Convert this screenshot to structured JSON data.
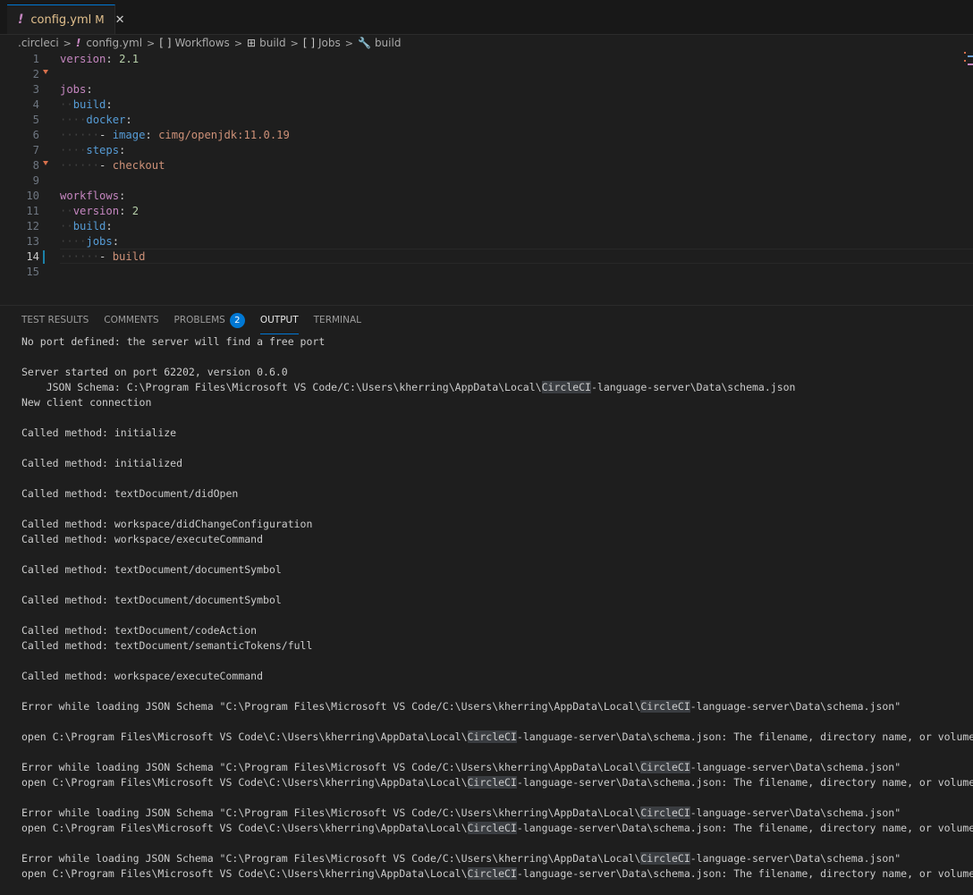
{
  "tab": {
    "icon": "!",
    "filename": "config.yml",
    "status": "M",
    "close": "✕"
  },
  "breadcrumb": {
    "items": [
      {
        "icon": "",
        "label": ".circleci"
      },
      {
        "icon": "!",
        "label": "config.yml"
      },
      {
        "icon": "[ ]",
        "label": "Workflows"
      },
      {
        "icon": "⊞",
        "label": "build"
      },
      {
        "icon": "[ ]",
        "label": "Jobs"
      },
      {
        "icon": "🔧",
        "label": "build"
      }
    ],
    "separator": ">"
  },
  "editor": {
    "active_line": 14,
    "lines": [
      {
        "n": "1",
        "indent": "",
        "key": "version",
        "sep": ": ",
        "val": "2.1",
        "vtype": "n"
      },
      {
        "n": "2",
        "indent": "",
        "key": "",
        "sep": "",
        "val": "",
        "vtype": ""
      },
      {
        "n": "3",
        "indent": "",
        "key": "jobs",
        "sep": ":",
        "val": "",
        "vtype": ""
      },
      {
        "n": "4",
        "indent": "··",
        "key": "build",
        "sep": ":",
        "val": "",
        "vtype": ""
      },
      {
        "n": "5",
        "indent": "····",
        "key": "docker",
        "sep": ":",
        "val": "",
        "vtype": ""
      },
      {
        "n": "6",
        "indent": "······- ",
        "key": "image",
        "sep": ": ",
        "val": "cimg/openjdk:11.0.19",
        "vtype": "v"
      },
      {
        "n": "7",
        "indent": "····",
        "key": "steps",
        "sep": ":",
        "val": "",
        "vtype": ""
      },
      {
        "n": "8",
        "indent": "······- ",
        "key": "",
        "sep": "",
        "val": "checkout",
        "vtype": "v"
      },
      {
        "n": "9",
        "indent": "",
        "key": "",
        "sep": "",
        "val": "",
        "vtype": ""
      },
      {
        "n": "10",
        "indent": "",
        "key": "workflows",
        "sep": ":",
        "val": "",
        "vtype": ""
      },
      {
        "n": "11",
        "indent": "··",
        "key": "version",
        "sep": ": ",
        "val": "2",
        "vtype": "n"
      },
      {
        "n": "12",
        "indent": "··",
        "key": "build",
        "sep": ":",
        "val": "",
        "vtype": ""
      },
      {
        "n": "13",
        "indent": "····",
        "key": "jobs",
        "sep": ":",
        "val": "",
        "vtype": ""
      },
      {
        "n": "14",
        "indent": "······- ",
        "key": "",
        "sep": "",
        "val": "build",
        "vtype": "v"
      },
      {
        "n": "15",
        "indent": "",
        "key": "",
        "sep": "",
        "val": "",
        "vtype": ""
      }
    ]
  },
  "panel": {
    "tabs": [
      {
        "label": "TEST RESULTS"
      },
      {
        "label": "COMMENTS"
      },
      {
        "label": "PROBLEMS",
        "badge": "2"
      },
      {
        "label": "OUTPUT",
        "active": true
      },
      {
        "label": "TERMINAL"
      }
    ],
    "output_lines": [
      "No port defined: the server will find a free port",
      "",
      "Server started on port 62202, version 0.6.0",
      "    JSON Schema: C:\\Program Files\\Microsoft VS Code/C:\\Users\\kherring\\AppData\\Local\\CircleCI-language-server\\Data\\schema.json",
      "New client connection",
      "",
      "Called method: initialize",
      "",
      "Called method: initialized",
      "",
      "Called method: textDocument/didOpen",
      "",
      "Called method: workspace/didChangeConfiguration",
      "Called method: workspace/executeCommand",
      "",
      "Called method: textDocument/documentSymbol",
      "",
      "Called method: textDocument/documentSymbol",
      "",
      "Called method: textDocument/codeAction",
      "Called method: textDocument/semanticTokens/full",
      "",
      "Called method: workspace/executeCommand",
      "",
      "Error while loading JSON Schema \"C:\\Program Files\\Microsoft VS Code/C:\\Users\\kherring\\AppData\\Local\\CircleCI-language-server\\Data\\schema.json\"",
      "",
      "open C:\\Program Files\\Microsoft VS Code\\C:\\Users\\kherring\\AppData\\Local\\CircleCI-language-server\\Data\\schema.json: The filename, directory name, or volume",
      "",
      "Error while loading JSON Schema \"C:\\Program Files\\Microsoft VS Code/C:\\Users\\kherring\\AppData\\Local\\CircleCI-language-server\\Data\\schema.json\"",
      "open C:\\Program Files\\Microsoft VS Code\\C:\\Users\\kherring\\AppData\\Local\\CircleCI-language-server\\Data\\schema.json: The filename, directory name, or volume",
      "",
      "Error while loading JSON Schema \"C:\\Program Files\\Microsoft VS Code/C:\\Users\\kherring\\AppData\\Local\\CircleCI-language-server\\Data\\schema.json\"",
      "open C:\\Program Files\\Microsoft VS Code\\C:\\Users\\kherring\\AppData\\Local\\CircleCI-language-server\\Data\\schema.json: The filename, directory name, or volume",
      "",
      "Error while loading JSON Schema \"C:\\Program Files\\Microsoft VS Code/C:\\Users\\kherring\\AppData\\Local\\CircleCI-language-server\\Data\\schema.json\"",
      "open C:\\Program Files\\Microsoft VS Code\\C:\\Users\\kherring\\AppData\\Local\\CircleCI-language-server\\Data\\schema.json: The filename, directory name, or volume"
    ],
    "highlight_term": "CircleCI"
  }
}
